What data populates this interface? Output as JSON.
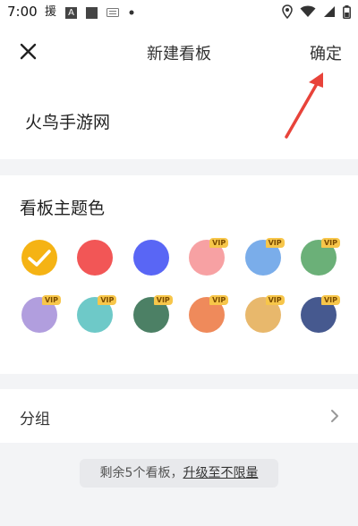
{
  "status_bar": {
    "time": "7:00",
    "icons": [
      "notification-icon",
      "a-icon",
      "square-icon",
      "keyboard-icon",
      "dot-icon",
      "location-icon",
      "wifi-icon",
      "signal-icon",
      "battery-icon"
    ],
    "notif_glyph": "援",
    "a_glyph": "A"
  },
  "header": {
    "title": "新建看板",
    "confirm_label": "确定"
  },
  "board_name": "火鸟手游网",
  "theme": {
    "title": "看板主题色",
    "vip_badge": "VIP",
    "selected_index": 0,
    "colors": [
      {
        "hex": "#f5b314",
        "vip": false
      },
      {
        "hex": "#f25656",
        "vip": false
      },
      {
        "hex": "#5966f5",
        "vip": false
      },
      {
        "hex": "#f7a1a3",
        "vip": true
      },
      {
        "hex": "#7aadea",
        "vip": true
      },
      {
        "hex": "#6bb078",
        "vip": true
      },
      {
        "hex": "#b19ede",
        "vip": true
      },
      {
        "hex": "#6ec9c8",
        "vip": true
      },
      {
        "hex": "#4c8065",
        "vip": true
      },
      {
        "hex": "#ef8a5b",
        "vip": true
      },
      {
        "hex": "#e8b86c",
        "vip": true
      },
      {
        "hex": "#46598f",
        "vip": true
      }
    ]
  },
  "group": {
    "label": "分组"
  },
  "tip": {
    "prefix": "剩余5个看板，",
    "link": "升级至不限量"
  },
  "colors": {
    "annotation_arrow": "#e8433a",
    "check": "#ffffff"
  }
}
